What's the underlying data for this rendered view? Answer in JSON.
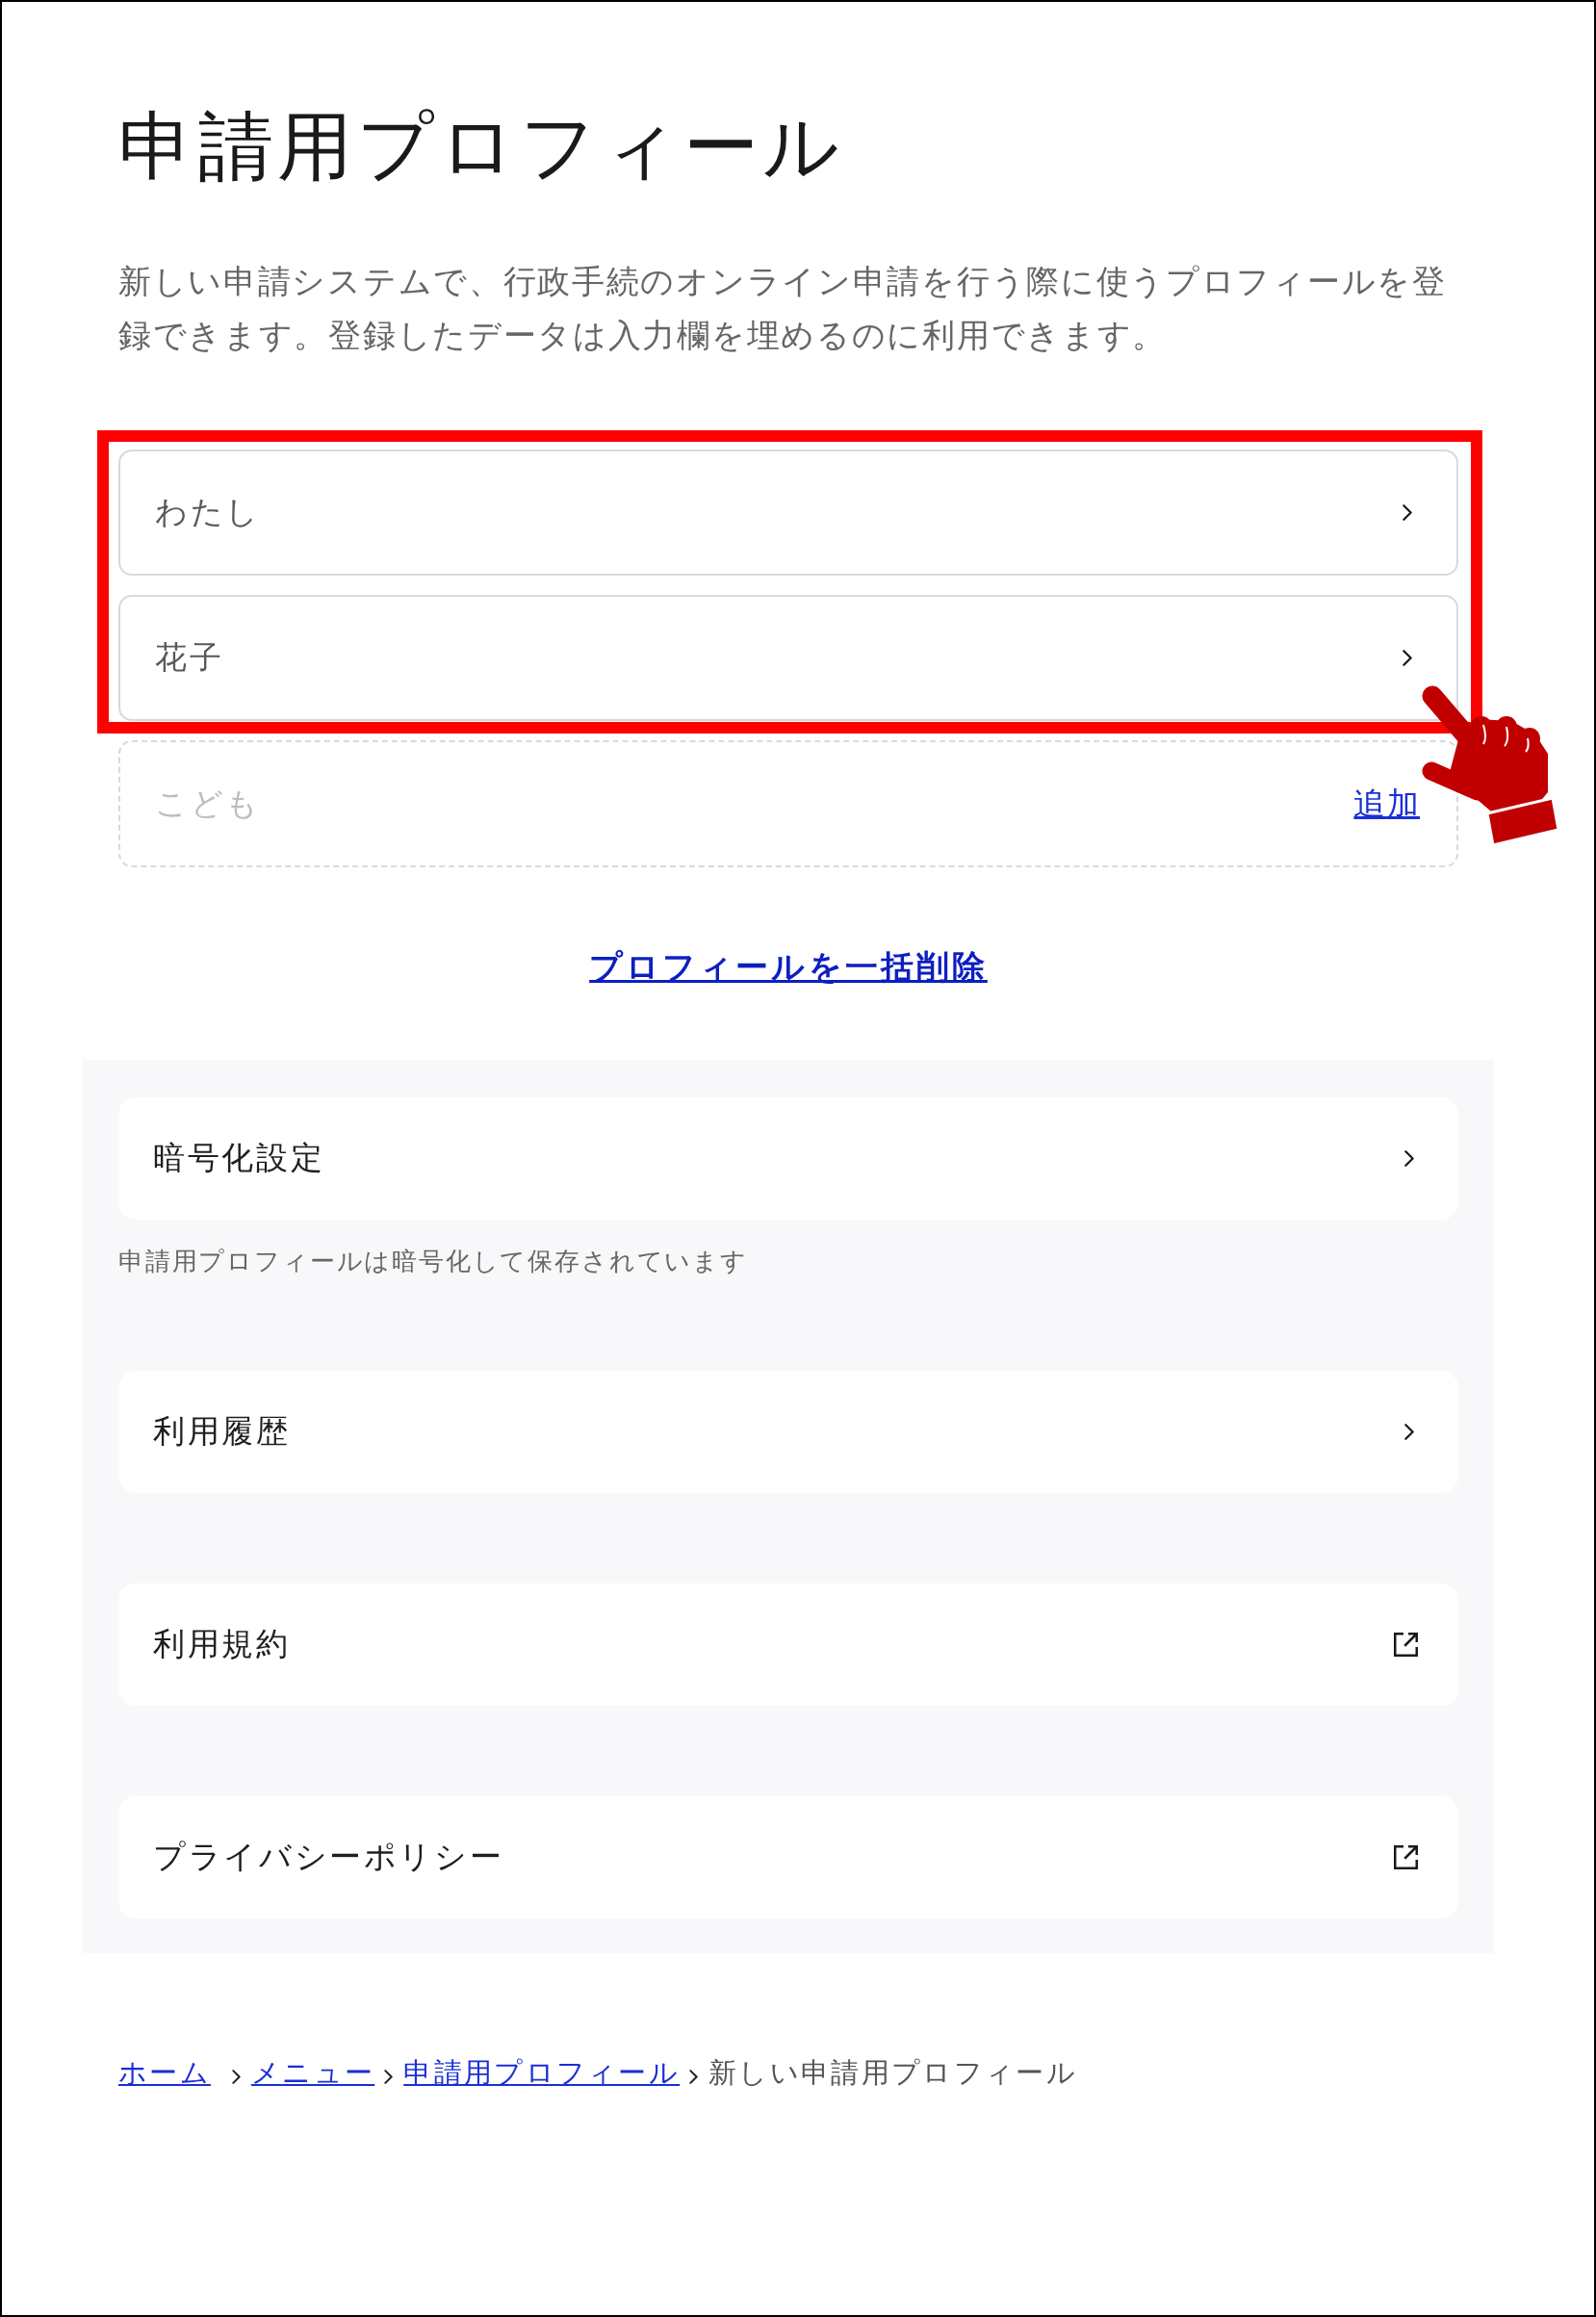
{
  "page": {
    "title": "申請用プロフィール",
    "description": "新しい申請システムで、行政手続のオンライン申請を行う際に使うプロフィールを登録できます。登録したデータは入力欄を埋めるのに利用できます。"
  },
  "profiles": [
    {
      "kind": "registered",
      "name": "わたし"
    },
    {
      "kind": "registered",
      "name": "花子"
    },
    {
      "kind": "empty",
      "name": "こども",
      "action": "追加"
    }
  ],
  "bulk_delete_link": "プロフィールを一括削除",
  "settings": [
    {
      "kind": "internal",
      "label": "暗号化設定",
      "note": "申請用プロフィールは暗号化して保存されています"
    },
    {
      "kind": "internal",
      "label": "利用履歴"
    },
    {
      "kind": "external",
      "label": "利用規約"
    },
    {
      "kind": "external",
      "label": "プライバシーポリシー"
    }
  ],
  "breadcrumb": [
    {
      "kind": "link",
      "label": "ホーム"
    },
    {
      "kind": "link",
      "label": "メニュー"
    },
    {
      "kind": "link",
      "label": "申請用プロフィール"
    },
    {
      "kind": "current",
      "label": "新しい申請用プロフィール"
    }
  ]
}
